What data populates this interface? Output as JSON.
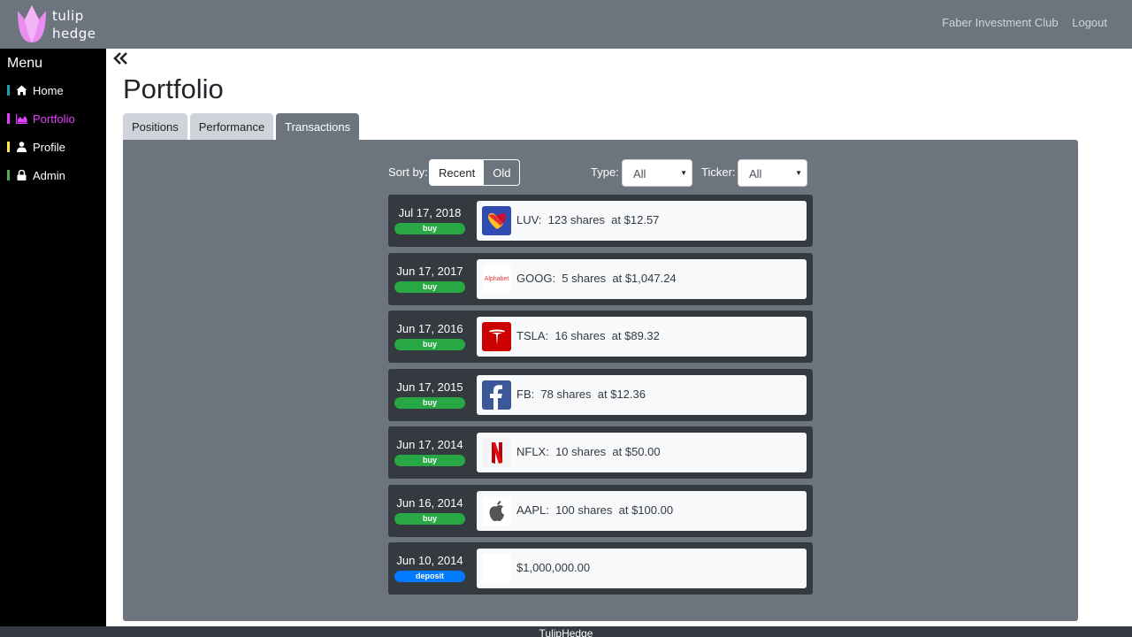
{
  "app": {
    "brand_line1": "tulip",
    "brand_line2": "hedge",
    "brand_color": "#e98ef0"
  },
  "topnav": {
    "club": "Faber Investment Club",
    "logout": "Logout"
  },
  "sidebar": {
    "title": "Menu",
    "items": [
      {
        "label": "Home",
        "icon": "home-icon",
        "bar_color": "#17a2b8"
      },
      {
        "label": "Portfolio",
        "icon": "chart-area-icon",
        "bar_color": "#e040fb"
      },
      {
        "label": "Profile",
        "icon": "user-icon",
        "bar_color": "#ffeb3b"
      },
      {
        "label": "Admin",
        "icon": "lock-icon",
        "bar_color": "#4caf50"
      }
    ]
  },
  "main": {
    "title": "Portfolio",
    "tabs": [
      "Positions",
      "Performance",
      "Transactions"
    ],
    "active_tab": "Transactions"
  },
  "controls": {
    "sort_label": "Sort by:",
    "sort_recent": "Recent",
    "sort_old": "Old",
    "sort_selected": "Old",
    "type_label": "Type:",
    "type_value": "All",
    "ticker_label": "Ticker:",
    "ticker_value": "All"
  },
  "transactions": [
    {
      "date": "Jul 17, 2018",
      "type": "buy",
      "text": "LUV:  123 shares  at $12.57",
      "logo": "southwest-logo"
    },
    {
      "date": "Jun 17, 2017",
      "type": "buy",
      "text": "GOOG:  5 shares  at $1,047.24",
      "logo": "alphabet-logo",
      "logo_text": "Alphabet"
    },
    {
      "date": "Jun 17, 2016",
      "type": "buy",
      "text": "TSLA:  16 shares  at $89.32",
      "logo": "tesla-logo"
    },
    {
      "date": "Jun 17, 2015",
      "type": "buy",
      "text": "FB:  78 shares  at $12.36",
      "logo": "facebook-logo"
    },
    {
      "date": "Jun 17, 2014",
      "type": "buy",
      "text": "NFLX:  10 shares  at $50.00",
      "logo": "netflix-logo"
    },
    {
      "date": "Jun 16, 2014",
      "type": "buy",
      "text": "AAPL:  100 shares  at $100.00",
      "logo": "apple-logo"
    },
    {
      "date": "Jun 10, 2014",
      "type": "deposit",
      "text": "$1,000,000.00",
      "logo": ""
    }
  ],
  "footer": {
    "text": "TulipHedge"
  }
}
